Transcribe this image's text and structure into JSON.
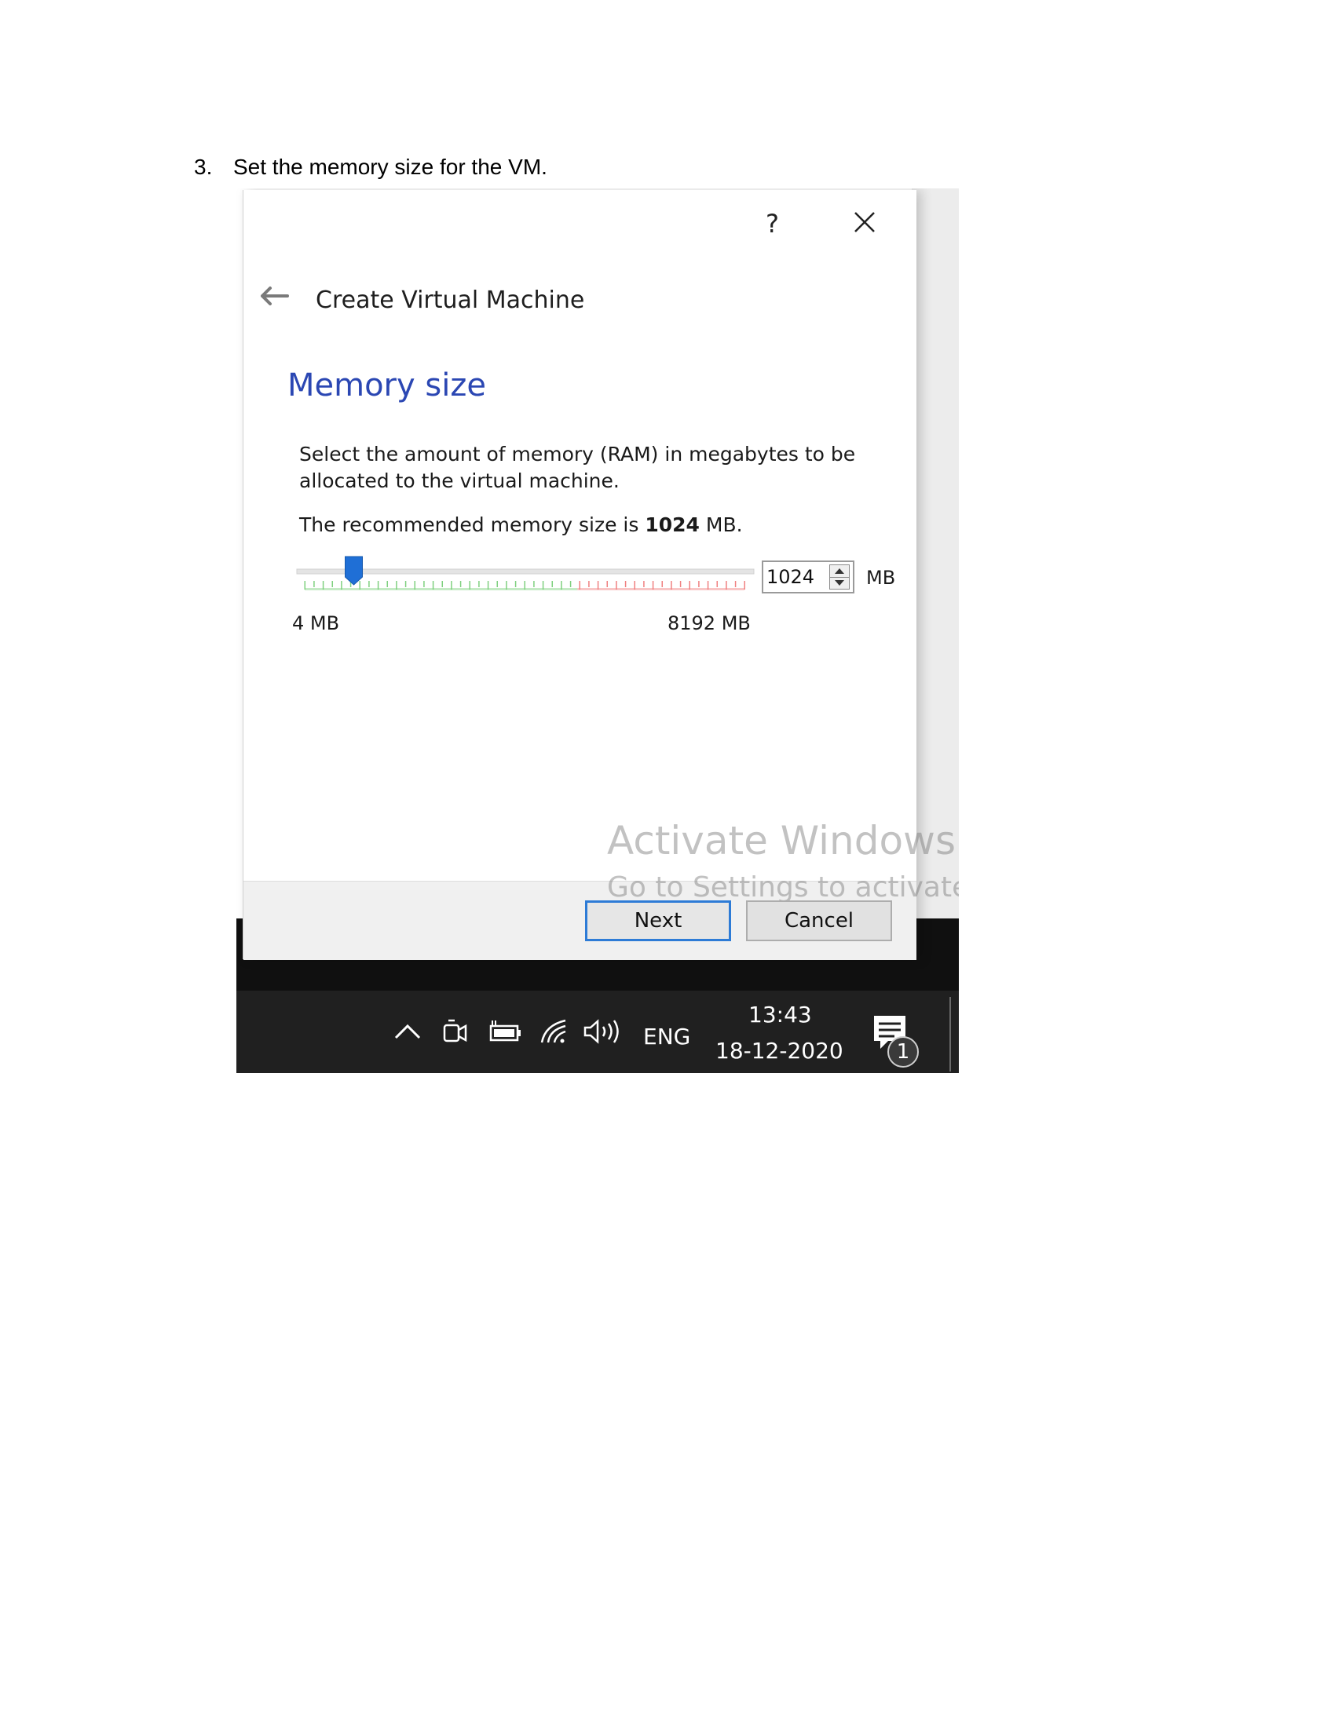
{
  "document": {
    "step_number": "3.",
    "step_text": "Set the memory size for the VM."
  },
  "dialog": {
    "help_label": "?",
    "title": "Create Virtual Machine",
    "section_title": "Memory size",
    "description": "Select the amount of memory (RAM) in megabytes to be allocated to the virtual machine.",
    "recommend_prefix": "The recommended memory size is ",
    "recommend_value": "1024",
    "recommend_suffix": " MB.",
    "slider": {
      "min_label": "4 MB",
      "max_label": "8192 MB",
      "min": 4,
      "max": 8192,
      "value": 1024,
      "green_until_fraction": 0.62
    },
    "spin_value": "1024",
    "unit": "MB",
    "buttons": {
      "next": "Next",
      "cancel": "Cancel"
    }
  },
  "watermark": {
    "title": "Activate Windows",
    "subtitle": "Go to Settings to activate Windows."
  },
  "taskbar": {
    "language": "ENG",
    "time": "13:43",
    "date": "18-12-2020",
    "notification_count": "1",
    "icons": [
      "chevron-up-icon",
      "meet-now-icon",
      "battery-icon",
      "wifi-icon",
      "volume-icon",
      "action-center-icon"
    ]
  },
  "colors": {
    "accent": "#2b47b3",
    "slider_thumb": "#1f6fd6",
    "next_border": "#2d7bd6",
    "tick_green": "#7fd07f",
    "tick_red": "#f08080"
  }
}
